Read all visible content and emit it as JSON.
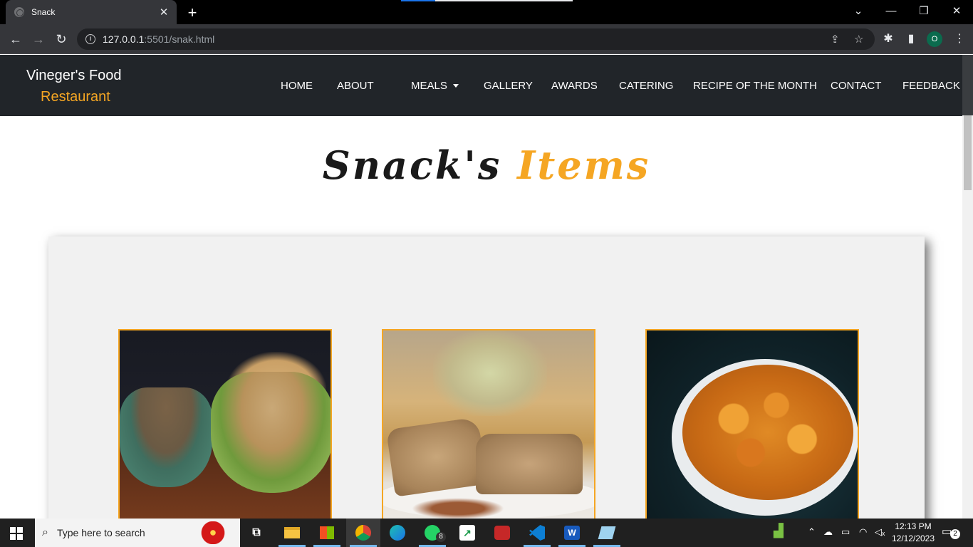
{
  "browser": {
    "tab_title": "Snack",
    "tab_close": "✕",
    "new_tab": "+",
    "url_host": "127.0.0.1",
    "url_path": ":5501/snak.html",
    "profile_initial": "O",
    "window_controls": [
      "⌄",
      "—",
      "❐",
      "✕"
    ]
  },
  "site": {
    "brand_name": "Vineger's Food",
    "brand_sub": "Restaurant",
    "nav": [
      {
        "label": "HOME"
      },
      {
        "label": "ABOUT"
      },
      {
        "label": "MEALS",
        "dropdown": true
      },
      {
        "label": "GALLERY"
      },
      {
        "label": "AWARDS"
      },
      {
        "label": "CATERING"
      },
      {
        "label": "RECIPE OF THE MONTH"
      },
      {
        "label": "CONTACT"
      },
      {
        "label": "FEEDBACK"
      }
    ],
    "page_title_part1": "Snack's",
    "page_title_part2": "Items",
    "accent_color": "#f5a623",
    "header_bg": "#212529",
    "food_images": [
      "chips-and-salsa-photo",
      "nut-bars-photo",
      "banana-chips-photo"
    ]
  },
  "taskbar": {
    "search_placeholder": "Type here to search",
    "whatsapp_badge": "8",
    "time": "12:13 PM",
    "date": "12/12/2023",
    "notification_count": "2",
    "apps": [
      "task-view-icon",
      "file-explorer-icon",
      "store-icon",
      "chrome-icon",
      "edge-icon",
      "whatsapp-icon",
      "stocks-icon",
      "recorder-icon",
      "vscode-icon",
      "word-icon",
      "notepad-icon"
    ]
  }
}
